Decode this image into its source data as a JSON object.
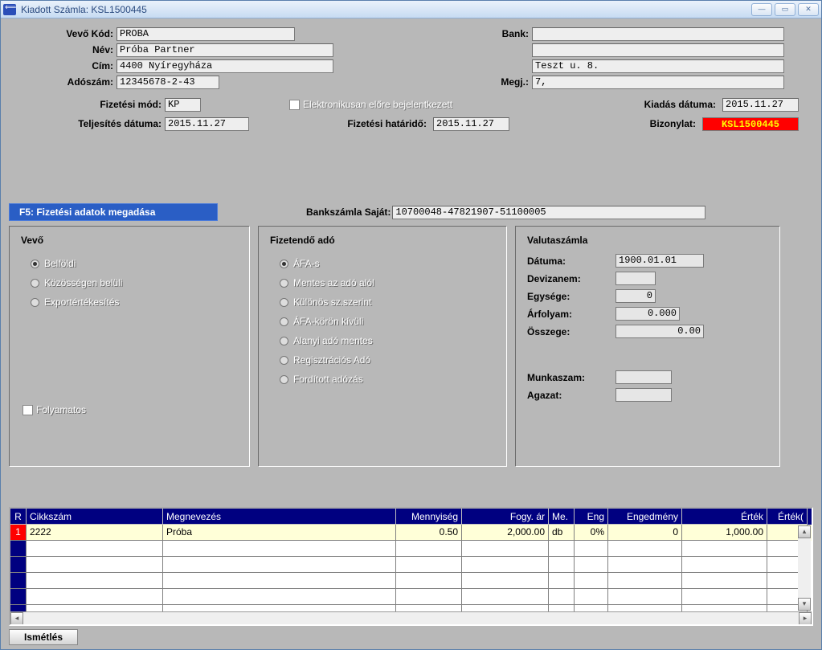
{
  "window": {
    "title": "Kiadott Számla:  KSL1500445"
  },
  "header": {
    "vevo_kod_label": "Vevő  Kód:",
    "vevo_kod": "PROBA",
    "bank_label": "Bank:",
    "bank": "",
    "nev_label": "Név:",
    "nev": "Próba Partner",
    "nev2": "",
    "cim_label": "Cím:",
    "cim": "4400 Nyíregyháza",
    "cim2": "Teszt u. 8.",
    "adoszam_label": "Adószám:",
    "adoszam": "12345678-2-43",
    "megj_label": "Megj.:",
    "megj": "7,"
  },
  "dates": {
    "fiz_mod_label": "Fizetési mód:",
    "fiz_mod": "KP",
    "elektronikus_label": "Elektronikusan előre bejelentkezett",
    "kiadas_label": "Kiadás dátuma:",
    "kiadas": "2015.11.27",
    "teljesites_label": "Teljesítés dátuma:",
    "teljesites": "2015.11.27",
    "fiz_hatarido_label": "Fizetési határidő:",
    "fiz_hatarido": "2015.11.27",
    "bizonylat_label": "Bizonylat:",
    "bizonylat": "KSL1500445"
  },
  "tabs": {
    "f5": "F5: Fizetési adatok megadása",
    "bankszamla_label": "Bankszámla Saját:",
    "bankszamla": "10700048-47821907-51100005"
  },
  "vevo_panel": {
    "title": "Vevő",
    "belfoldi": "Belföldi",
    "kozossegen": "Közösségen belüli",
    "export": "Exportértékesítés",
    "folyamatos": "Folyamatos"
  },
  "ado_panel": {
    "title": "Fizetendő adó",
    "afas": "ÁFA-s",
    "mentes": "Mentes az adó alól",
    "kulonos": "Különös sz.szerint",
    "afakoron": "ÁFA-körön kívüli",
    "alanyi": "Alanyi adó mentes",
    "regisztracios": "Regisztrációs Adó",
    "forditott": "Fordított adózás"
  },
  "valuta": {
    "title": "Valutaszámla",
    "datuma_label": "Dátuma:",
    "datuma": "1900.01.01",
    "devizanem_label": "Devizanem:",
    "devizanem": "",
    "egysege_label": "Egysége:",
    "egysege": "0",
    "arfolyam_label": "Árfolyam:",
    "arfolyam": "0.000",
    "osszege_label": "Összege:",
    "osszege": "0.00",
    "munkaszam_label": "Munkaszam:",
    "munkaszam": "",
    "agazat_label": "Agazat:",
    "agazat": ""
  },
  "grid": {
    "headers": {
      "r": "R",
      "cikkszam": "Cikkszám",
      "megnevezes": "Megnevezés",
      "mennyiseg": "Mennyiség",
      "fogyar": "Fogy. ár",
      "me": "Me.",
      "eng": "Eng",
      "engedmeny": "Engedmény",
      "ertek": "Érték",
      "ertek2": "Érték("
    },
    "row1": {
      "r": "1",
      "cikkszam": "2222",
      "megnevezes": "Próba",
      "mennyiseg": "0.50",
      "fogyar": "2,000.00",
      "me": "db",
      "eng": "0%",
      "engedmeny": "0",
      "ertek": "1,000.00"
    }
  },
  "bottom": {
    "ismetles": "Ismétlés"
  }
}
